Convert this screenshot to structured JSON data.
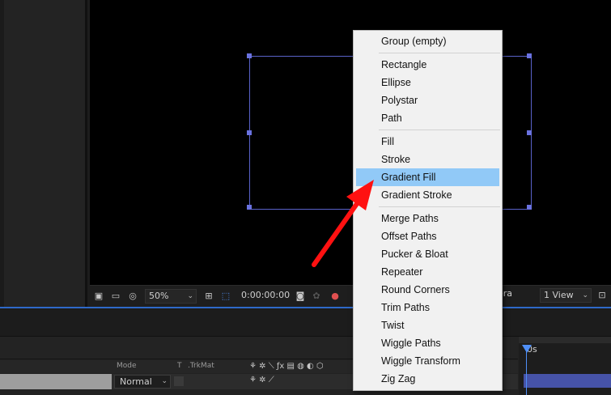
{
  "viewer_toolbar": {
    "zoom": "50%",
    "timecode": "0:00:00:00",
    "camera_fragment": "era",
    "views": "1 View"
  },
  "timeline": {
    "time_label": "0s",
    "columns": {
      "mode": "Mode",
      "t": "T",
      "trkmat": ".TrkMat"
    },
    "layer_mode": "Normal"
  },
  "context_menu": {
    "groups": [
      [
        "Group (empty)"
      ],
      [
        "Rectangle",
        "Ellipse",
        "Polystar",
        "Path"
      ],
      [
        "Fill",
        "Stroke",
        "Gradient Fill",
        "Gradient Stroke"
      ],
      [
        "Merge Paths",
        "Offset Paths",
        "Pucker & Bloat",
        "Repeater",
        "Round Corners",
        "Trim Paths",
        "Twist",
        "Wiggle Paths",
        "Wiggle Transform",
        "Zig Zag"
      ]
    ],
    "highlighted": "Gradient Fill"
  },
  "colors": {
    "highlight": "#91c9f7",
    "annotation_arrow": "#ff1111",
    "shape_outline": "#5962c9",
    "panel_divider": "#2e69c9"
  }
}
